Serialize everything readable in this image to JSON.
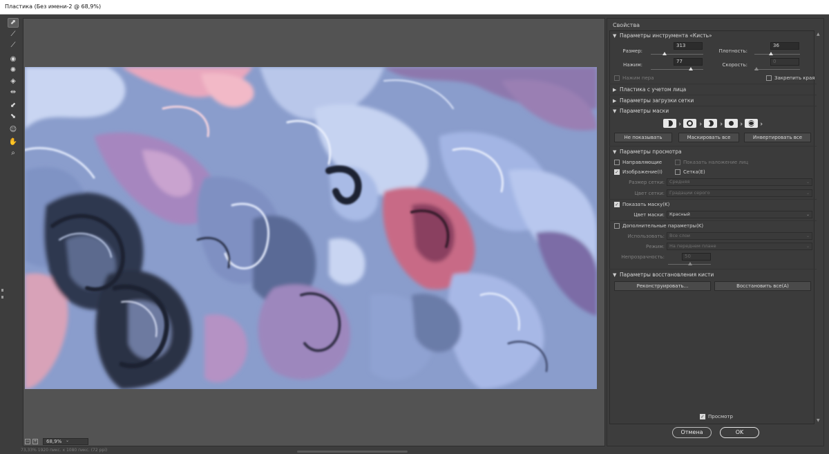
{
  "window": {
    "title": "Пластика (Без имени-2 @ 68,9%)"
  },
  "toolbar": {
    "tools": [
      {
        "icon": "forward-warp-icon",
        "glyph": "⬈",
        "active": true
      },
      {
        "icon": "reconstruct-icon",
        "glyph": "⟋"
      },
      {
        "icon": "smooth-icon",
        "glyph": "⟋"
      },
      {
        "icon": "twirl-icon",
        "glyph": "◉"
      },
      {
        "icon": "pucker-icon",
        "glyph": "✺"
      },
      {
        "icon": "bloat-icon",
        "glyph": "◈"
      },
      {
        "icon": "push-left-icon",
        "glyph": "⇹"
      },
      {
        "icon": "freeze-mask-icon",
        "glyph": "⬋"
      },
      {
        "icon": "thaw-mask-icon",
        "glyph": "⬊"
      },
      {
        "icon": "face-tool-icon",
        "glyph": "☺"
      },
      {
        "icon": "hand-icon",
        "glyph": "✋"
      },
      {
        "icon": "zoom-icon",
        "glyph": "🔍"
      }
    ]
  },
  "zoom": {
    "value": "68,9%"
  },
  "status": {
    "text": "73,33%     1920 пикс. x 1080 пикс. (72 ppi)"
  },
  "panel": {
    "title": "Свойства",
    "brush": {
      "header": "Параметры инструмента «Кисть»",
      "size_label": "Размер:",
      "size_value": "313",
      "size_level": 0.42,
      "density_label": "Плотность:",
      "density_value": "36",
      "density_level": 0.36,
      "pressure_label": "Нажим:",
      "pressure_value": "77",
      "pressure_level": 0.77,
      "rate_label": "Скорость:",
      "rate_value": "0",
      "rate_level": 0.0,
      "stylus_label": "Нажим пера",
      "pin_edges_label": "Закрепить края"
    },
    "face_aware": {
      "header": "Пластика с учетом лица"
    },
    "load_mesh": {
      "header": "Параметры загрузки сетки"
    },
    "mask": {
      "header": "Параметры маски",
      "none_label": "Не показывать",
      "mask_all_label": "Маскировать все",
      "invert_all_label": "Инвертировать все"
    },
    "view": {
      "header": "Параметры просмотра",
      "guides_label": "Направляющие",
      "face_overlay_label": "Показать наложение лиц",
      "image_label": "Изображение(I)",
      "mesh_label": "Сетка(E)",
      "mesh_size_label": "Размер сетки:",
      "mesh_size_value": "Средняя",
      "mesh_color_label": "Цвет сетки:",
      "mesh_color_value": "Градации серого",
      "show_mask_label": "Показать маску(K)",
      "mask_color_label": "Цвет маски:",
      "mask_color_value": "Красный",
      "backdrop_label": "Дополнительные параметры(K)",
      "use_label": "Использовать:",
      "use_value": "Все слои",
      "mode_label": "Режим:",
      "mode_value": "На переднем плане",
      "opacity_label": "Непрозрачность:",
      "opacity_value": "50",
      "opacity_level": 0.5
    },
    "reconstruct": {
      "header": "Параметры восстановления кисти",
      "reconstruct_label": "Реконструировать...",
      "restore_all_label": "Восстановить все(A)"
    },
    "preview_label": "Просмотр",
    "cancel_label": "Отмена",
    "ok_label": "OK"
  },
  "colors": {
    "canvas_base": "#8a9dcc",
    "canvas_pink": "#e9a7bd",
    "canvas_purple": "#9a7fb3",
    "canvas_dark": "#2a3145",
    "canvas_light": "#c6d3f1"
  }
}
